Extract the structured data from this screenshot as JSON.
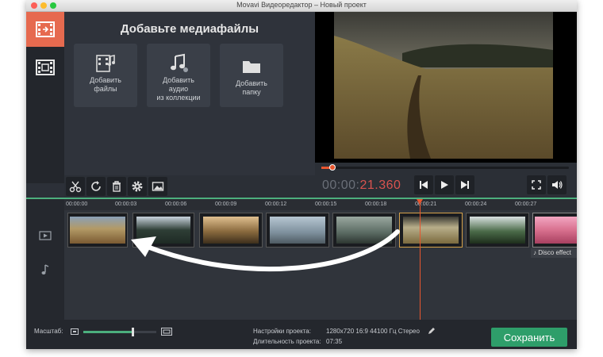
{
  "window": {
    "title": "Movavi Видеоредактор – Новый проект"
  },
  "sidebar": {
    "tabs": [
      {
        "icon": "film-import-icon"
      },
      {
        "icon": "film-icon"
      }
    ]
  },
  "media": {
    "heading": "Добавьте медиафайлы",
    "tiles": [
      {
        "icon": "add-files-icon",
        "label": "Добавить\nфайлы"
      },
      {
        "icon": "music-note-icon",
        "label": "Добавить\nаудио\nиз коллекции"
      },
      {
        "icon": "folder-icon",
        "label": "Добавить\nпапку"
      }
    ]
  },
  "player": {
    "timecode_dim": "00:00:",
    "timecode_red": "21.360"
  },
  "tools": [
    {
      "icon": "scissors-icon"
    },
    {
      "icon": "rotate-icon"
    },
    {
      "icon": "trash-icon"
    },
    {
      "icon": "gear-icon"
    },
    {
      "icon": "image-icon"
    }
  ],
  "ruler": {
    "ticks": [
      "00:00:00",
      "00:00:03",
      "00:00:06",
      "00:00:09",
      "00:00:12",
      "00:00:15",
      "00:00:18",
      "00:00:21",
      "00:00:24",
      "00:00:27"
    ]
  },
  "timeline": {
    "title_clip": "Disco effect"
  },
  "footer": {
    "zoom_label": "Масштаб:",
    "settings_label": "Настройки проекта:",
    "settings_value": "1280x720 16:9 44100 Гц Стерео",
    "duration_label": "Длительность проекта:",
    "duration_value": "07:35",
    "save_label": "Сохранить"
  },
  "colors": {
    "accent": "#2e9e6a",
    "playhead": "#e8562f",
    "timecode_red": "#d9534f"
  }
}
